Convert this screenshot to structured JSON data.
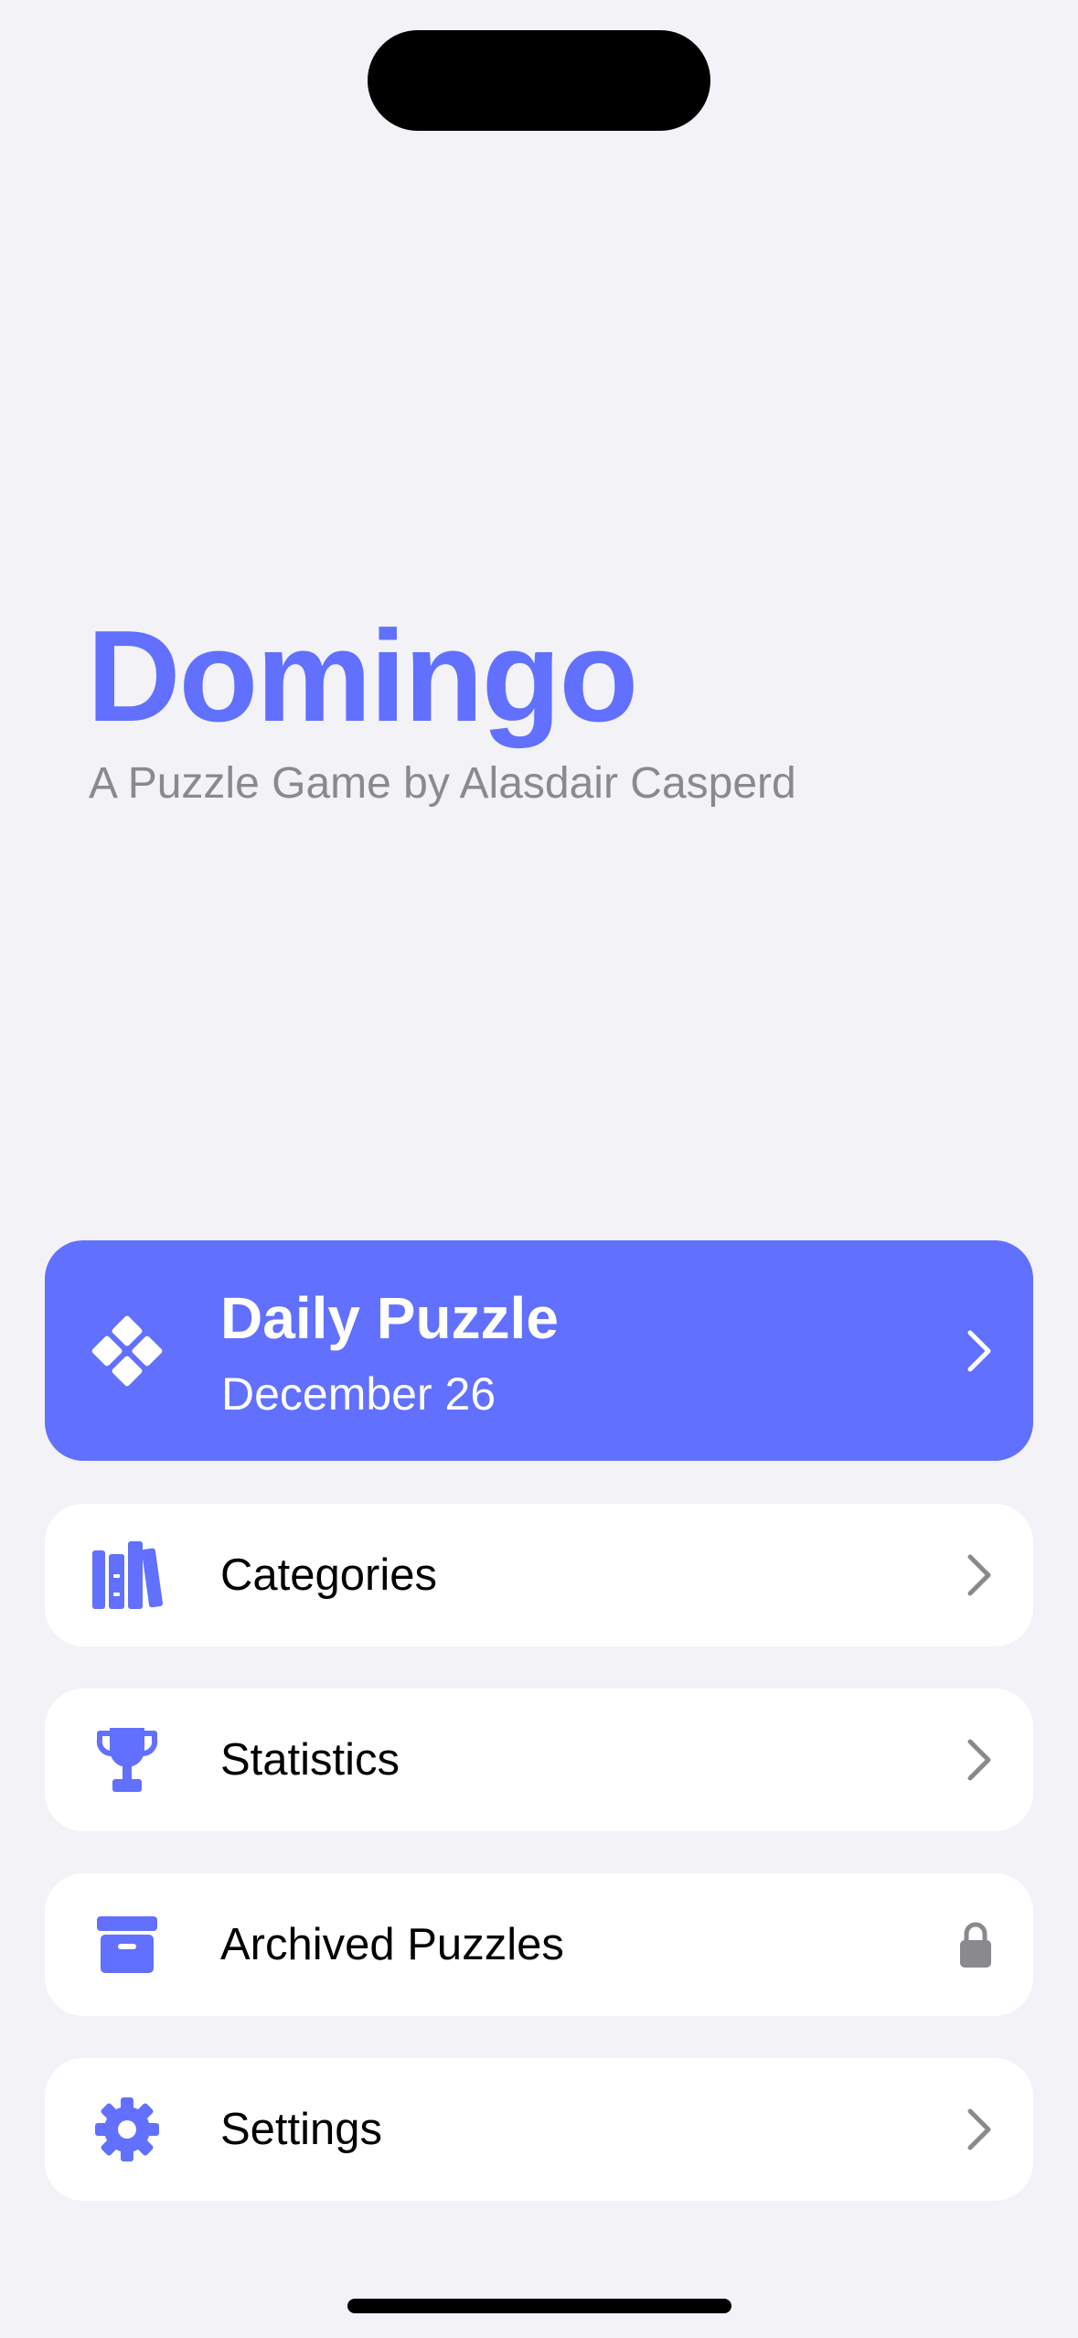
{
  "app": {
    "title": "Domingo",
    "subtitle": "A Puzzle Game by Alasdair Casperd"
  },
  "colors": {
    "accent": "#6170FF",
    "background": "#F2F2F7",
    "card": "#FFFFFF",
    "chevron": "#8A8A8E",
    "subtitle": "#8A8A8E"
  },
  "daily": {
    "title": "Daily Puzzle",
    "date": "December 26",
    "icon": "domino-diamond-icon"
  },
  "menu": [
    {
      "label": "Categories",
      "icon": "books-icon",
      "trailing": "chevron-right-icon"
    },
    {
      "label": "Statistics",
      "icon": "trophy-icon",
      "trailing": "chevron-right-icon"
    },
    {
      "label": "Archived Puzzles",
      "icon": "archive-box-icon",
      "trailing": "lock-icon"
    },
    {
      "label": "Settings",
      "icon": "gear-icon",
      "trailing": "chevron-right-icon"
    }
  ]
}
